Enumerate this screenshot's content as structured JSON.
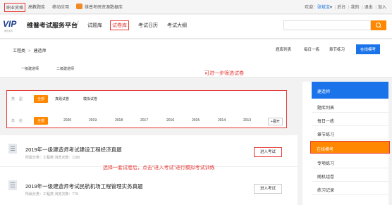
{
  "topbar": {
    "links": [
      "职业资格",
      "高教题库",
      "移动应用",
      "维普考研资源数据库"
    ],
    "welcome_label": "欢迎：",
    "user": "张斌宝",
    "user_arrow": "▾",
    "right_links": [
      "后台",
      "我的",
      "退出",
      "加入"
    ]
  },
  "header": {
    "logo": "VIP",
    "logo_sub": "维普资讯",
    "platform_title": "维普考试服务平台",
    "slash": "/",
    "nav": [
      "试题库",
      "试卷库",
      "考试日历",
      "考试大纲"
    ],
    "active_nav": "试卷库"
  },
  "breadcrumb": {
    "items": [
      "工程类",
      "建造师"
    ],
    "separator": ">"
  },
  "subcategories": [
    "一级建造师",
    "二级建造师"
  ],
  "right_tabs": [
    "题库列表",
    "每日一练",
    "章节练习",
    "在线模考"
  ],
  "right_tab_active": "在线模考",
  "annotations": {
    "filter_note": "可进一步筛选试卷",
    "enter_note": "选择一套试卷后，点击“进入考试”进行模拟考试训练"
  },
  "filter": {
    "type_label": "类型",
    "year_label": "年份",
    "all": "全部",
    "types": [
      "真题试卷",
      "模拟试卷"
    ],
    "years": [
      "2020",
      "2019",
      "2018",
      "2017",
      "2016",
      "2015",
      "2014",
      "2013"
    ],
    "expand": "+展开"
  },
  "papers": [
    {
      "title": "2019年一级建造师考试建设工程经济真题",
      "meta": "所属分类：工程类  浏览次数：1100",
      "button": "进入考试"
    },
    {
      "title": "2019年一级建造师考试民航机场工程管理实务真题",
      "meta": "所属分类：工程类  浏览次数：779",
      "button": "进入考试"
    }
  ],
  "sidebar": {
    "header": "建造师",
    "items": [
      "题库列表",
      "每日一练",
      "章节练习",
      "在线模考",
      "专项练习",
      "随机组卷",
      "练习记录"
    ],
    "active": "在线模考"
  },
  "colors": {
    "accent": "#ff8800",
    "primary": "#1a73e8",
    "annotation": "#e53935"
  }
}
